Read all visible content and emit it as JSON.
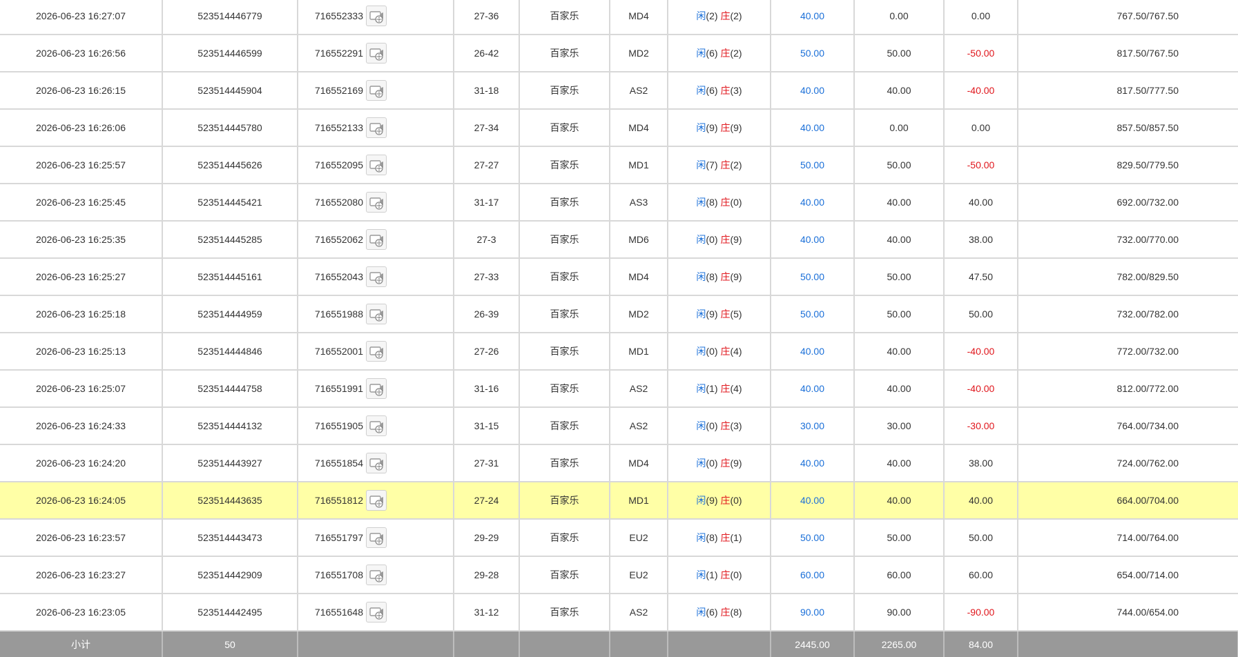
{
  "colors": {
    "blue": "#1a6fd8",
    "red": "#e0161c",
    "highlight": "#ffffa6",
    "subtotal_bg": "#999999"
  },
  "icons": {
    "replay": "video-replay-icon"
  },
  "labels": {
    "player": "闲",
    "banker": "庄"
  },
  "rows": [
    {
      "time": "2026-06-23 16:27:07",
      "order_id": "523514446779",
      "round_id": "716552333",
      "shoe": "27-36",
      "game": "百家乐",
      "table": "MD4",
      "player": "(2)",
      "banker": "(2)",
      "bet": "40.00",
      "valid": "0.00",
      "result": "0.00",
      "result_color": "normal",
      "balance": "767.50/767.50"
    },
    {
      "time": "2026-06-23 16:26:56",
      "order_id": "523514446599",
      "round_id": "716552291",
      "shoe": "26-42",
      "game": "百家乐",
      "table": "MD2",
      "player": "(6)",
      "banker": "(2)",
      "bet": "50.00",
      "valid": "50.00",
      "result": "-50.00",
      "result_color": "red",
      "balance": "817.50/767.50"
    },
    {
      "time": "2026-06-23 16:26:15",
      "order_id": "523514445904",
      "round_id": "716552169",
      "shoe": "31-18",
      "game": "百家乐",
      "table": "AS2",
      "player": "(6)",
      "banker": "(3)",
      "bet": "40.00",
      "valid": "40.00",
      "result": "-40.00",
      "result_color": "red",
      "balance": "817.50/777.50"
    },
    {
      "time": "2026-06-23 16:26:06",
      "order_id": "523514445780",
      "round_id": "716552133",
      "shoe": "27-34",
      "game": "百家乐",
      "table": "MD4",
      "player": "(9)",
      "banker": "(9)",
      "bet": "40.00",
      "valid": "0.00",
      "result": "0.00",
      "result_color": "normal",
      "balance": "857.50/857.50"
    },
    {
      "time": "2026-06-23 16:25:57",
      "order_id": "523514445626",
      "round_id": "716552095",
      "shoe": "27-27",
      "game": "百家乐",
      "table": "MD1",
      "player": "(7)",
      "banker": "(2)",
      "bet": "50.00",
      "valid": "50.00",
      "result": "-50.00",
      "result_color": "red",
      "balance": "829.50/779.50"
    },
    {
      "time": "2026-06-23 16:25:45",
      "order_id": "523514445421",
      "round_id": "716552080",
      "shoe": "31-17",
      "game": "百家乐",
      "table": "AS3",
      "player": "(8)",
      "banker": "(0)",
      "bet": "40.00",
      "valid": "40.00",
      "result": "40.00",
      "result_color": "normal",
      "balance": "692.00/732.00"
    },
    {
      "time": "2026-06-23 16:25:35",
      "order_id": "523514445285",
      "round_id": "716552062",
      "shoe": "27-3",
      "game": "百家乐",
      "table": "MD6",
      "player": "(0)",
      "banker": "(9)",
      "bet": "40.00",
      "valid": "40.00",
      "result": "38.00",
      "result_color": "normal",
      "balance": "732.00/770.00"
    },
    {
      "time": "2026-06-23 16:25:27",
      "order_id": "523514445161",
      "round_id": "716552043",
      "shoe": "27-33",
      "game": "百家乐",
      "table": "MD4",
      "player": "(8)",
      "banker": "(9)",
      "bet": "50.00",
      "valid": "50.00",
      "result": "47.50",
      "result_color": "normal",
      "balance": "782.00/829.50"
    },
    {
      "time": "2026-06-23 16:25:18",
      "order_id": "523514444959",
      "round_id": "716551988",
      "shoe": "26-39",
      "game": "百家乐",
      "table": "MD2",
      "player": "(9)",
      "banker": "(5)",
      "bet": "50.00",
      "valid": "50.00",
      "result": "50.00",
      "result_color": "normal",
      "balance": "732.00/782.00"
    },
    {
      "time": "2026-06-23 16:25:13",
      "order_id": "523514444846",
      "round_id": "716552001",
      "shoe": "27-26",
      "game": "百家乐",
      "table": "MD1",
      "player": "(0)",
      "banker": "(4)",
      "bet": "40.00",
      "valid": "40.00",
      "result": "-40.00",
      "result_color": "red",
      "balance": "772.00/732.00"
    },
    {
      "time": "2026-06-23 16:25:07",
      "order_id": "523514444758",
      "round_id": "716551991",
      "shoe": "31-16",
      "game": "百家乐",
      "table": "AS2",
      "player": "(1)",
      "banker": "(4)",
      "bet": "40.00",
      "valid": "40.00",
      "result": "-40.00",
      "result_color": "red",
      "balance": "812.00/772.00"
    },
    {
      "time": "2026-06-23 16:24:33",
      "order_id": "523514444132",
      "round_id": "716551905",
      "shoe": "31-15",
      "game": "百家乐",
      "table": "AS2",
      "player": "(0)",
      "banker": "(3)",
      "bet": "30.00",
      "valid": "30.00",
      "result": "-30.00",
      "result_color": "red",
      "balance": "764.00/734.00"
    },
    {
      "time": "2026-06-23 16:24:20",
      "order_id": "523514443927",
      "round_id": "716551854",
      "shoe": "27-31",
      "game": "百家乐",
      "table": "MD4",
      "player": "(0)",
      "banker": "(9)",
      "bet": "40.00",
      "valid": "40.00",
      "result": "38.00",
      "result_color": "normal",
      "balance": "724.00/762.00"
    },
    {
      "time": "2026-06-23 16:24:05",
      "order_id": "523514443635",
      "round_id": "716551812",
      "shoe": "27-24",
      "game": "百家乐",
      "table": "MD1",
      "player": "(9)",
      "banker": "(0)",
      "bet": "40.00",
      "valid": "40.00",
      "result": "40.00",
      "result_color": "normal",
      "balance": "664.00/704.00",
      "highlighted": true
    },
    {
      "time": "2026-06-23 16:23:57",
      "order_id": "523514443473",
      "round_id": "716551797",
      "shoe": "29-29",
      "game": "百家乐",
      "table": "EU2",
      "player": "(8)",
      "banker": "(1)",
      "bet": "50.00",
      "valid": "50.00",
      "result": "50.00",
      "result_color": "normal",
      "balance": "714.00/764.00"
    },
    {
      "time": "2026-06-23 16:23:27",
      "order_id": "523514442909",
      "round_id": "716551708",
      "shoe": "29-28",
      "game": "百家乐",
      "table": "EU2",
      "player": "(1)",
      "banker": "(0)",
      "bet": "60.00",
      "valid": "60.00",
      "result": "60.00",
      "result_color": "normal",
      "balance": "654.00/714.00"
    },
    {
      "time": "2026-06-23 16:23:05",
      "order_id": "523514442495",
      "round_id": "716551648",
      "shoe": "31-12",
      "game": "百家乐",
      "table": "AS2",
      "player": "(6)",
      "banker": "(8)",
      "bet": "90.00",
      "valid": "90.00",
      "result": "-90.00",
      "result_color": "red",
      "balance": "744.00/654.00"
    }
  ],
  "subtotal": {
    "label": "小计",
    "count": "50",
    "bet": "2445.00",
    "valid": "2265.00",
    "result": "84.00"
  }
}
